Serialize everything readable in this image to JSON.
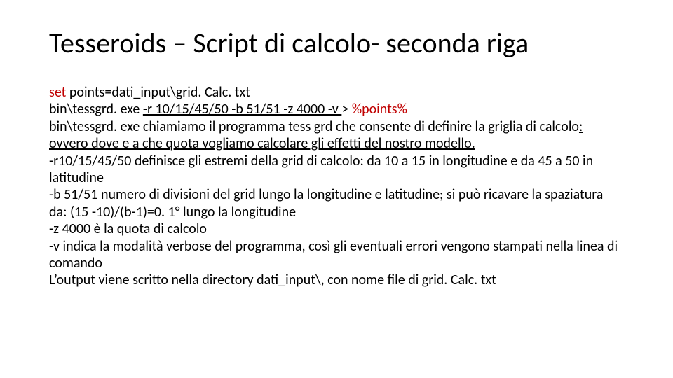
{
  "title": "Tesseroids – Script di calcolo- seconda riga",
  "line1_a": "set ",
  "line1_b": "points=dati_input\\grid. Calc. txt",
  "line2_a": "bin\\tessgrd. exe ",
  "line2_b": "-r 10/15/45/50 -b 51/51 -z 4000 -v ",
  "line2_c": "> ",
  "line2_d": "%points%",
  "line3_a": "bin\\tessgrd. exe chiamiamo il programma tess grd che consente di definire la griglia di calcolo",
  "line3_b": ": ovvero dove e a che quota vogliamo calcolare gli effetti del nostro modello.",
  "line4": "-r10/15/45/50 definisce gli estremi della grid di calcolo: da 10 a 15 in longitudine e da 45 a 50 in latitudine",
  "line5": "-b 51/51 numero di divisioni del grid lungo la longitudine e latitudine; si può ricavare la spaziatura da: (15 -10)/(b-1)=0. 1° lungo la longitudine",
  "line6": "-z 4000 è la quota di calcolo",
  "line7": "-v indica la modalità verbose del programma, così gli eventuali errori vengono stampati nella linea di comando",
  "line8": "L’output viene scritto nella directory dati_input\\, con nome file di grid. Calc. txt"
}
